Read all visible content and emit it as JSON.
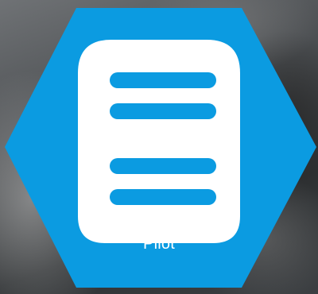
{
  "tile": {
    "label": "Pilot",
    "icon": "database-icon",
    "accent_color": "#0b9be1",
    "icon_color": "#ffffff"
  }
}
